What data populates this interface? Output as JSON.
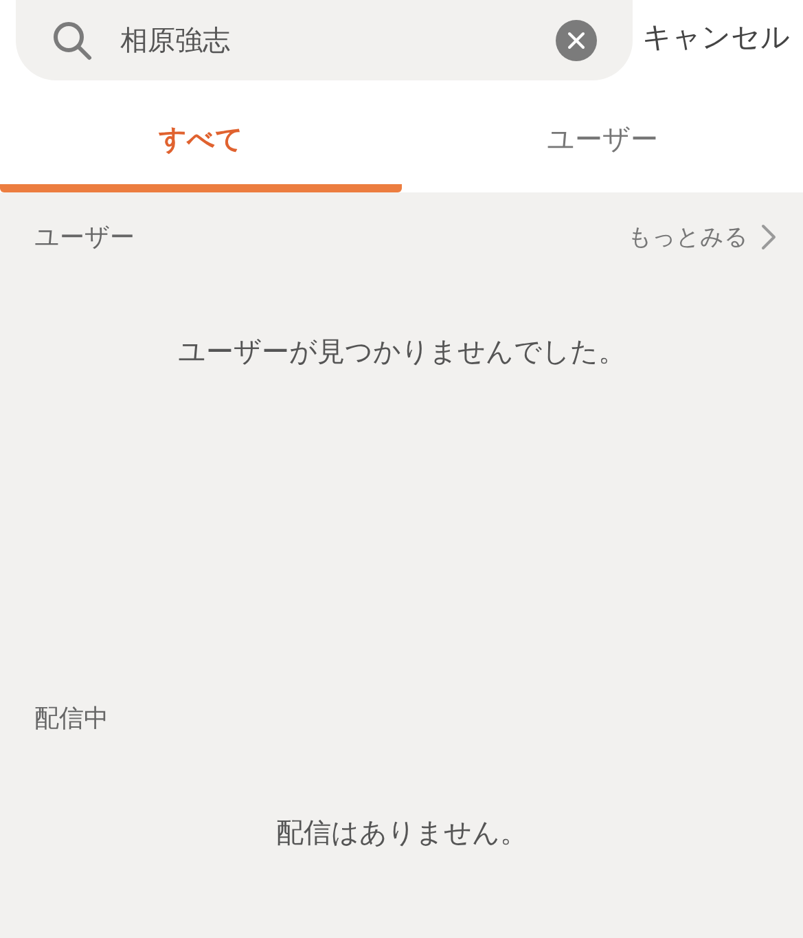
{
  "search": {
    "value": "相原強志"
  },
  "cancel": "キャンセル",
  "tabs": [
    {
      "label": "すべて",
      "selected": true
    },
    {
      "label": "ユーザー",
      "selected": false
    }
  ],
  "sections": [
    {
      "title": "ユーザー",
      "more": "もっとみる",
      "empty": "ユーザーが見つかりませんでした。"
    },
    {
      "title": "配信中",
      "empty": "配信はありません。"
    }
  ]
}
